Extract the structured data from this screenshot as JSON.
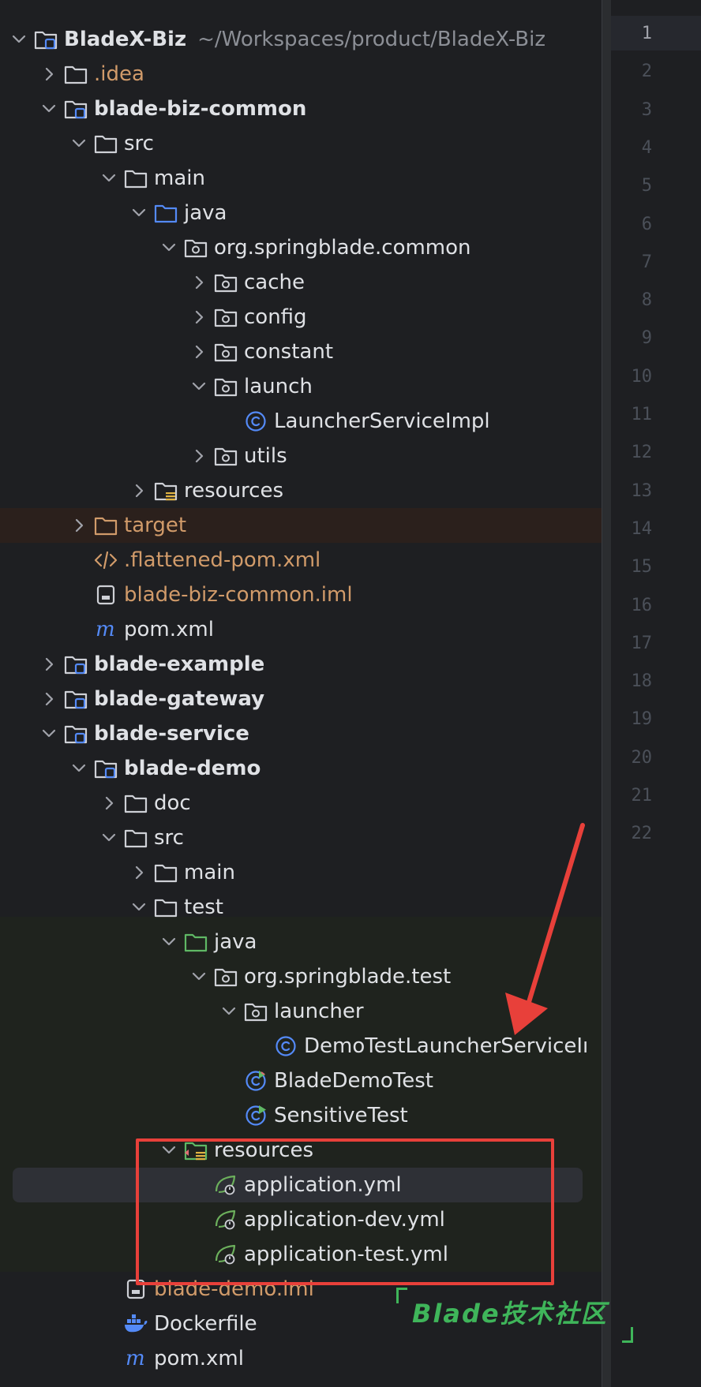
{
  "project_tree": {
    "rows": [
      {
        "label": "BladeX-Biz",
        "path": "~/Workspaces/product/BladeX-Biz",
        "depth": 0,
        "chevron": "down",
        "icon": "module-folder-icon",
        "style": "bold"
      },
      {
        "label": ".idea",
        "depth": 1,
        "chevron": "right",
        "icon": "folder-icon",
        "style": "orange"
      },
      {
        "label": "blade-biz-common",
        "depth": 1,
        "chevron": "down",
        "icon": "module-folder-icon",
        "style": "bold"
      },
      {
        "label": "src",
        "depth": 2,
        "chevron": "down",
        "icon": "folder-icon",
        "style": "normal"
      },
      {
        "label": "main",
        "depth": 3,
        "chevron": "down",
        "icon": "folder-icon",
        "style": "normal"
      },
      {
        "label": "java",
        "depth": 4,
        "chevron": "down",
        "icon": "source-folder-icon",
        "style": "normal"
      },
      {
        "label": "org.springblade.common",
        "depth": 5,
        "chevron": "down",
        "icon": "package-icon",
        "style": "normal"
      },
      {
        "label": "cache",
        "depth": 6,
        "chevron": "right",
        "icon": "package-icon",
        "style": "normal"
      },
      {
        "label": "config",
        "depth": 6,
        "chevron": "right",
        "icon": "package-icon",
        "style": "normal"
      },
      {
        "label": "constant",
        "depth": 6,
        "chevron": "right",
        "icon": "package-icon",
        "style": "normal"
      },
      {
        "label": "launch",
        "depth": 6,
        "chevron": "down",
        "icon": "package-icon",
        "style": "normal"
      },
      {
        "label": "LauncherServiceImpl",
        "depth": 7,
        "chevron": "none",
        "icon": "class-icon",
        "style": "normal"
      },
      {
        "label": "utils",
        "depth": 6,
        "chevron": "right",
        "icon": "package-icon",
        "style": "normal"
      },
      {
        "label": "resources",
        "depth": 4,
        "chevron": "right",
        "icon": "resources-folder-icon",
        "style": "normal"
      },
      {
        "label": "target",
        "depth": 2,
        "chevron": "right",
        "icon": "excluded-folder-icon",
        "style": "orange"
      },
      {
        "label": ".flattened-pom.xml",
        "depth": 2,
        "chevron": "none",
        "icon": "xml-file-icon",
        "style": "orange"
      },
      {
        "label": "blade-biz-common.iml",
        "depth": 2,
        "chevron": "none",
        "icon": "iml-file-icon",
        "style": "orange"
      },
      {
        "label": "pom.xml",
        "depth": 2,
        "chevron": "none",
        "icon": "maven-icon",
        "style": "normal"
      },
      {
        "label": "blade-example",
        "depth": 1,
        "chevron": "right",
        "icon": "module-folder-icon",
        "style": "bold"
      },
      {
        "label": "blade-gateway",
        "depth": 1,
        "chevron": "right",
        "icon": "module-folder-icon",
        "style": "bold"
      },
      {
        "label": "blade-service",
        "depth": 1,
        "chevron": "down",
        "icon": "module-folder-icon",
        "style": "bold"
      },
      {
        "label": "blade-demo",
        "depth": 2,
        "chevron": "down",
        "icon": "module-folder-icon",
        "style": "bold"
      },
      {
        "label": "doc",
        "depth": 3,
        "chevron": "right",
        "icon": "folder-icon",
        "style": "normal"
      },
      {
        "label": "src",
        "depth": 3,
        "chevron": "down",
        "icon": "folder-icon",
        "style": "normal"
      },
      {
        "label": "main",
        "depth": 4,
        "chevron": "right",
        "icon": "folder-icon",
        "style": "normal"
      },
      {
        "label": "test",
        "depth": 4,
        "chevron": "down",
        "icon": "folder-icon",
        "style": "normal"
      },
      {
        "label": "java",
        "depth": 5,
        "chevron": "down",
        "icon": "test-source-folder-icon",
        "style": "normal"
      },
      {
        "label": "org.springblade.test",
        "depth": 6,
        "chevron": "down",
        "icon": "package-icon",
        "style": "normal"
      },
      {
        "label": "launcher",
        "depth": 7,
        "chevron": "down",
        "icon": "package-icon",
        "style": "normal"
      },
      {
        "label": "DemoTestLauncherServiceIı",
        "depth": 8,
        "chevron": "none",
        "icon": "class-icon",
        "style": "normal"
      },
      {
        "label": "BladeDemoTest",
        "depth": 7,
        "chevron": "none",
        "icon": "test-class-icon",
        "style": "normal"
      },
      {
        "label": "SensitiveTest",
        "depth": 7,
        "chevron": "none",
        "icon": "test-class-run-icon",
        "style": "normal"
      },
      {
        "label": "resources",
        "depth": 5,
        "chevron": "down",
        "icon": "test-resources-folder-icon",
        "style": "normal"
      },
      {
        "label": "application.yml",
        "depth": 6,
        "chevron": "none",
        "icon": "spring-yml-icon",
        "style": "normal"
      },
      {
        "label": "application-dev.yml",
        "depth": 6,
        "chevron": "none",
        "icon": "spring-yml-icon",
        "style": "normal"
      },
      {
        "label": "application-test.yml",
        "depth": 6,
        "chevron": "none",
        "icon": "spring-yml-icon",
        "style": "normal"
      },
      {
        "label": "blade-demo.iml",
        "depth": 3,
        "chevron": "none",
        "icon": "iml-file-icon",
        "style": "orange"
      },
      {
        "label": "Dockerfile",
        "depth": 3,
        "chevron": "none",
        "icon": "docker-icon",
        "style": "normal"
      },
      {
        "label": "pom.xml",
        "depth": 3,
        "chevron": "none",
        "icon": "maven-icon",
        "style": "normal"
      }
    ],
    "selected_row": "application.yml"
  },
  "editor_gutter": {
    "line_numbers": [
      "1",
      "2",
      "3",
      "4",
      "5",
      "6",
      "7",
      "8",
      "9",
      "10",
      "11",
      "12",
      "13",
      "14",
      "15",
      "16",
      "17",
      "18",
      "19",
      "20",
      "21",
      "22"
    ],
    "current_line": "1"
  },
  "watermark": {
    "text": "Blade技术社区"
  },
  "colors": {
    "background": "#1e1f22",
    "text": "#dfe1e5",
    "excluded_text": "#d19b6a",
    "annotation_red": "#e8403a",
    "watermark_green": "#3fb55a"
  }
}
